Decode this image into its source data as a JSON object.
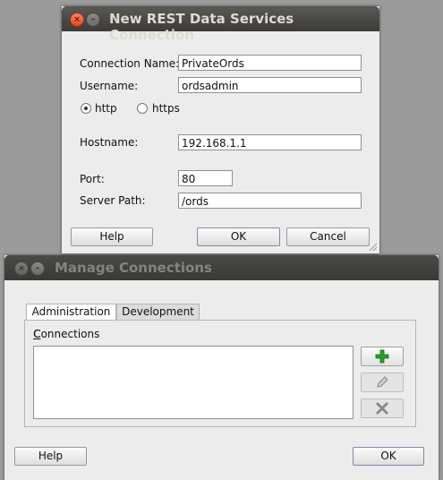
{
  "rest_dialog": {
    "title": "New REST Data Services Connection",
    "connection_name_label": "Connection Name:",
    "connection_name_value": "PrivateOrds",
    "username_label": "Username:",
    "username_value": "ordsadmin",
    "http_label": "http",
    "https_label": "https",
    "hostname_label": "Hostname:",
    "hostname_value": "192.168.1.1",
    "port_label": "Port:",
    "port_value": "80",
    "server_path_label": "Server Path:",
    "server_path_value": "/ords",
    "help_label": "Help",
    "ok_label": "OK",
    "cancel_label": "Cancel",
    "selected_protocol": "http"
  },
  "manage_dialog": {
    "title": "Manage Connections",
    "tabs": [
      {
        "label": "Administration",
        "active": true
      },
      {
        "label": "Development",
        "active": false
      }
    ],
    "connections_label": "Connections",
    "tools": {
      "add": "plus-icon",
      "edit": "pencil-icon",
      "remove": "x-icon"
    },
    "help_label": "Help",
    "ok_label": "OK"
  },
  "colors": {
    "titlebar": "#3c3b37",
    "window_bg": "#ececec",
    "add_green": "#2aa12a"
  }
}
